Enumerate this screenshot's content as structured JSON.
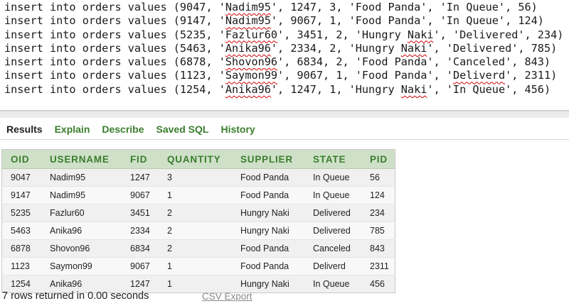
{
  "editor": {
    "lines": [
      {
        "pre": "insert into orders values (9047, '",
        "user": "Nadim95",
        "post": "', 1247, 3, 'Food Panda', 'In Queue', 56)"
      },
      {
        "pre": "insert into orders values (9147, '",
        "user": "Nadim95",
        "post": "', 9067, 1, 'Food Panda', 'In Queue', 124)"
      },
      {
        "pre": "insert into orders values (5235, '",
        "user": "Fazlur60",
        "post": "', 3451, 2, 'Hungry Naki', 'Delivered', 234)"
      },
      {
        "pre": "insert into orders values (5463, '",
        "user": "Anika96",
        "post": "', 2334, 2, 'Hungry Naki', 'Delivered', 785)"
      },
      {
        "pre": "insert into orders values (6878, '",
        "user": "Shovon96",
        "post": "', 6834, 2, 'Food Panda', 'Canceled', 843)"
      },
      {
        "pre": "insert into orders values (1123, '",
        "user": "Saymon99",
        "post": "', 9067, 1, 'Food Panda', 'Deliverd', 2311)"
      },
      {
        "pre": "insert into orders values (1254, '",
        "user": "Anika96",
        "post": "', 1247, 1, 'Hungry Naki', 'In Queue', 456)"
      }
    ],
    "misspelled": [
      "Naki",
      "Deliverd"
    ]
  },
  "tabs": {
    "results": "Results",
    "explain": "Explain",
    "describe": "Describe",
    "saved_sql": "Saved SQL",
    "history": "History"
  },
  "table": {
    "columns": [
      "OID",
      "USERNAME",
      "FID",
      "QUANTITY",
      "SUPPLIER",
      "STATE",
      "PID"
    ],
    "rows": [
      [
        "9047",
        "Nadim95",
        "1247",
        "3",
        "Food Panda",
        "In Queue",
        "56"
      ],
      [
        "9147",
        "Nadim95",
        "9067",
        "1",
        "Food Panda",
        "In Queue",
        "124"
      ],
      [
        "5235",
        "Fazlur60",
        "3451",
        "2",
        "Hungry Naki",
        "Delivered",
        "234"
      ],
      [
        "5463",
        "Anika96",
        "2334",
        "2",
        "Hungry Naki",
        "Delivered",
        "785"
      ],
      [
        "6878",
        "Shovon96",
        "6834",
        "2",
        "Food Panda",
        "Canceled",
        "843"
      ],
      [
        "1123",
        "Saymon99",
        "9067",
        "1",
        "Food Panda",
        "Deliverd",
        "2311"
      ],
      [
        "1254",
        "Anika96",
        "1247",
        "1",
        "Hungry Naki",
        "In Queue",
        "456"
      ]
    ]
  },
  "footer": {
    "status": "7 rows returned in 0.00 seconds",
    "csv_export": "CSV Export"
  },
  "colors": {
    "accent_green": "#3a7d2d",
    "header_bg": "#cfe0c8",
    "spell_underline": "#d40000"
  }
}
